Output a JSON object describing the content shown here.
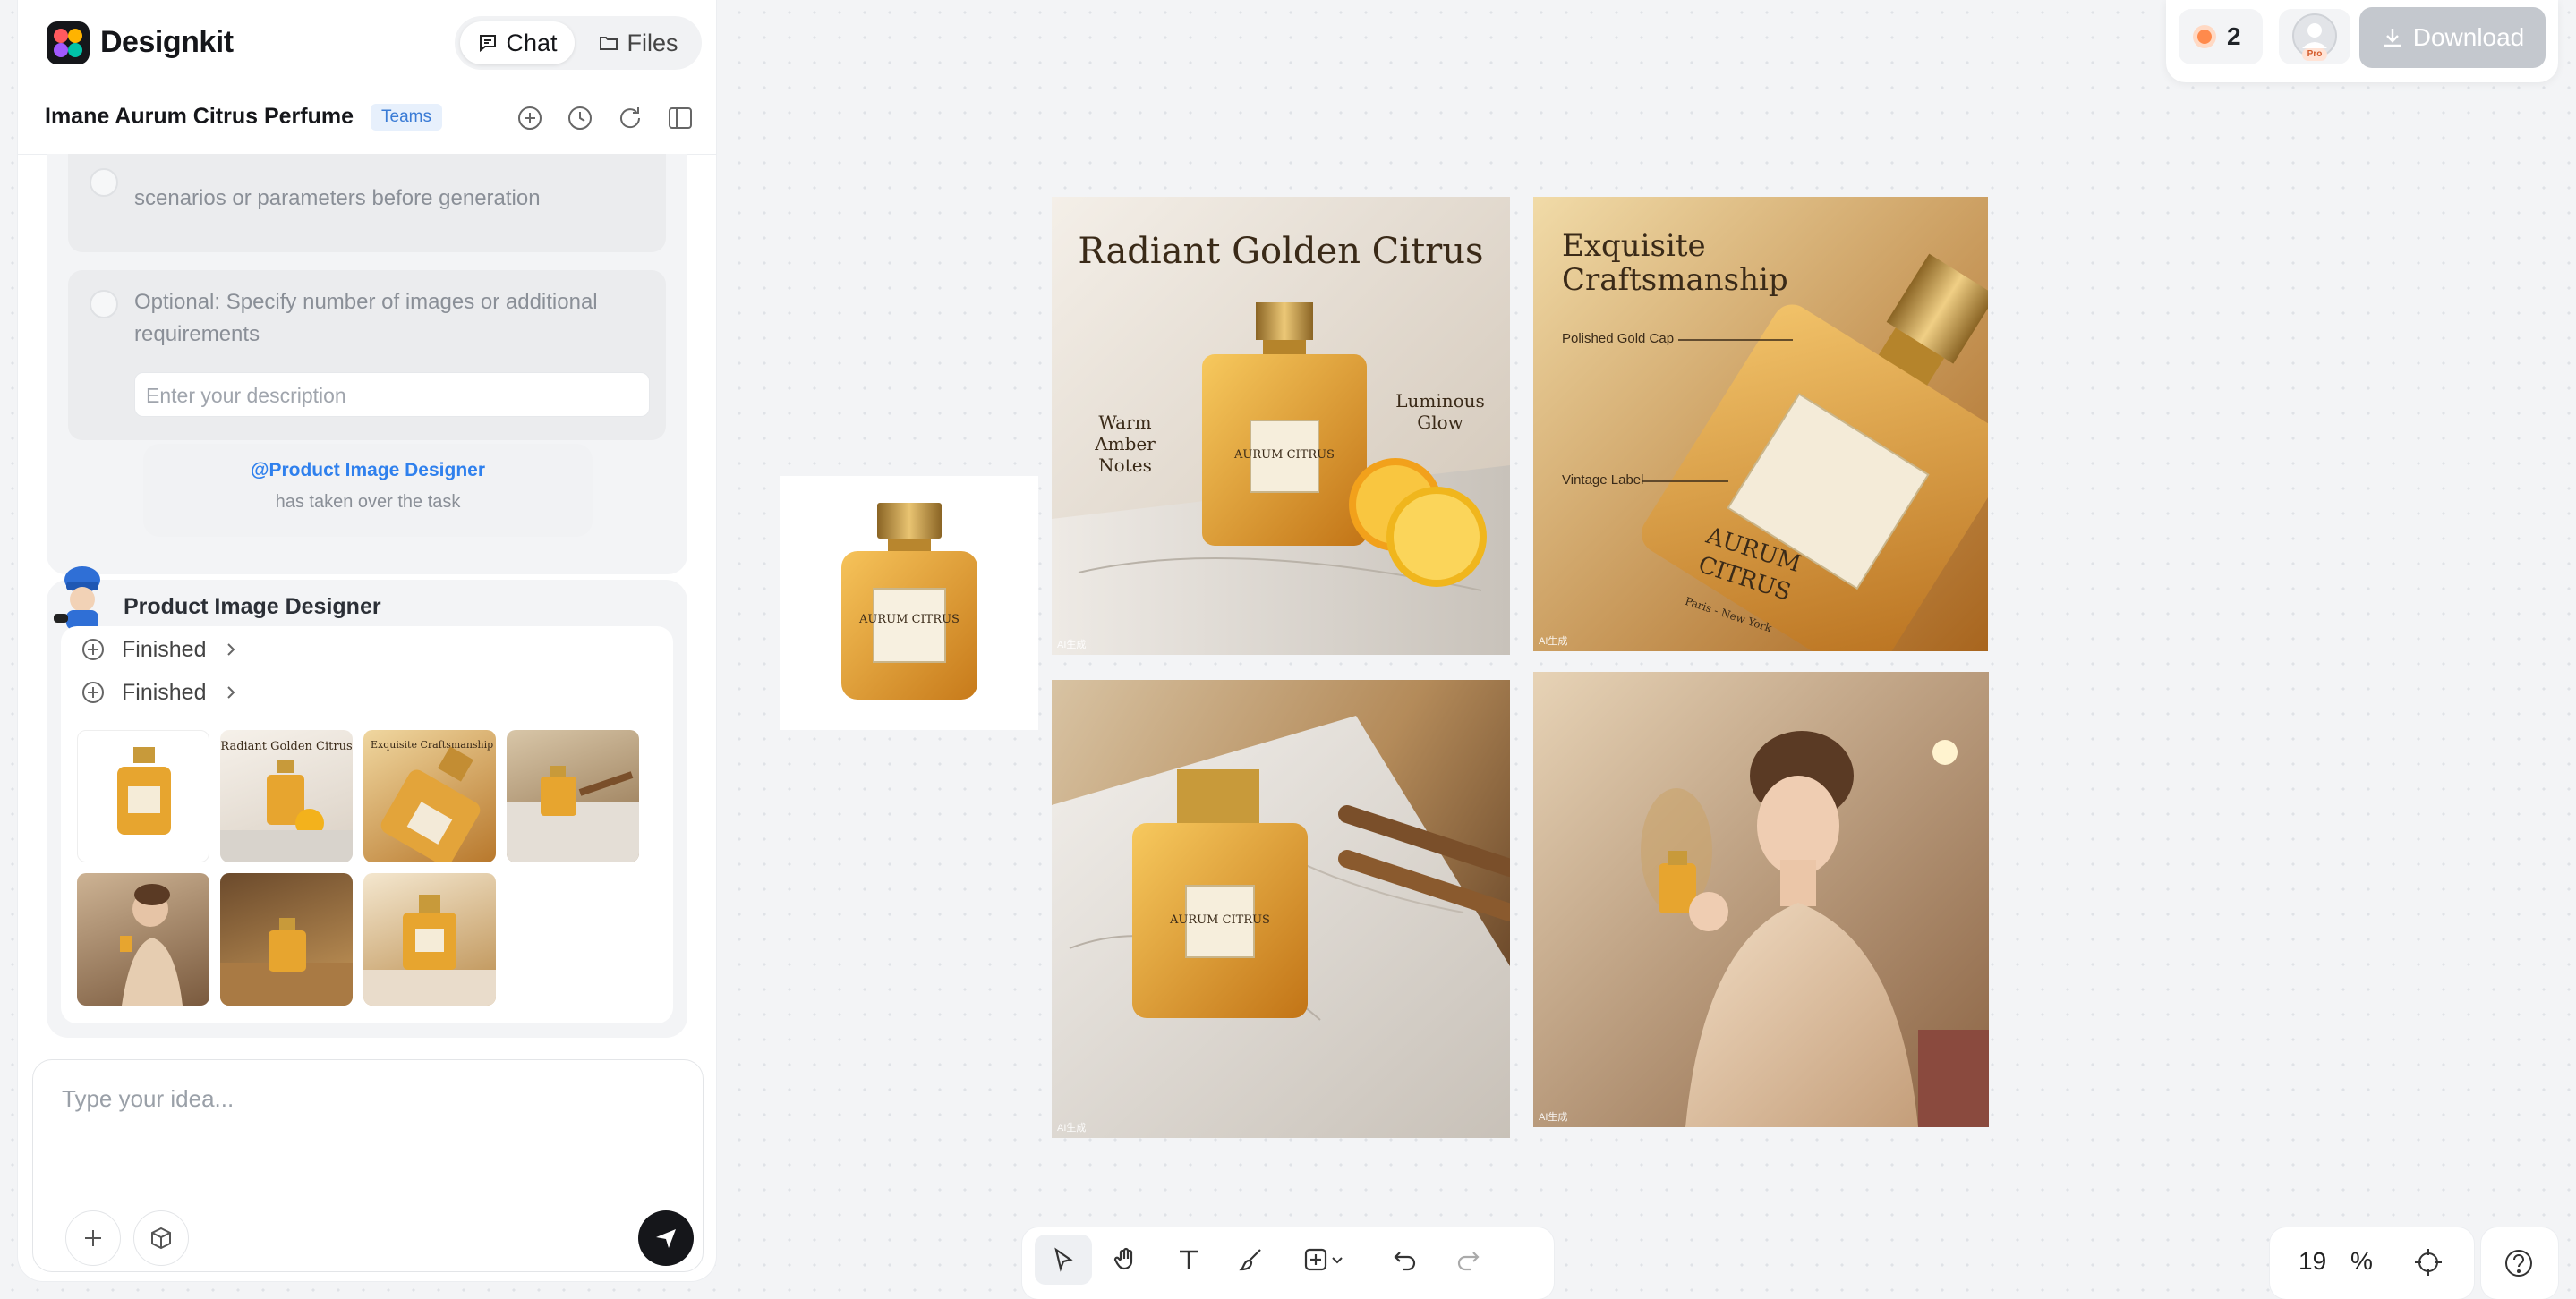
{
  "app": {
    "name": "Designkit"
  },
  "header": {
    "tabs": [
      {
        "label": "Chat",
        "active": true
      },
      {
        "label": "Files",
        "active": false
      }
    ]
  },
  "project": {
    "title": "Imane Aurum Citrus Perfume",
    "badge": "Teams"
  },
  "chat": {
    "option_cut_text": "scenarios or parameters before generation",
    "option2_text": "Optional: Specify number of images or additional requirements",
    "description_placeholder": "Enter your description",
    "takeover": {
      "who": "@Product Image Designer",
      "what": "has taken over the task"
    },
    "agent": {
      "name": "Product Image Designer",
      "steps": [
        {
          "label": "Finished"
        },
        {
          "label": "Finished"
        }
      ]
    }
  },
  "composer": {
    "placeholder": "Type your idea..."
  },
  "topright": {
    "credits": "2",
    "plan": "Pro",
    "download": "Download"
  },
  "canvas": {
    "img1": {
      "title": "Radiant Golden Citrus",
      "left_note": "Warm Amber Notes",
      "right_note": "Luminous Glow"
    },
    "img2": {
      "title": "Exquisite Craftsmanship",
      "callout1": "Polished Gold Cap",
      "callout2": "Vintage Label",
      "label_line1": "AURUM",
      "label_line2": "CITRUS",
      "label_line3": "Paris - New York"
    },
    "bottle_label": "AURUM CITRUS",
    "watermark": "AI生成"
  },
  "zoom": {
    "value": "19",
    "unit": "%"
  },
  "colors": {
    "accent": "#2f80ed",
    "gold": "#e2a63a",
    "dark": "#15161a"
  }
}
